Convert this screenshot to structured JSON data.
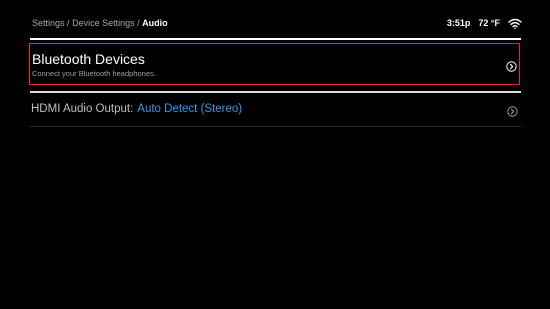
{
  "breadcrumb": {
    "items": [
      "Settings",
      "Device Settings"
    ],
    "separator": "/",
    "current": "Audio"
  },
  "status": {
    "time": "3:51p",
    "temperature": "72 °F",
    "wifi_icon": "wifi-icon"
  },
  "menu": {
    "bluetooth": {
      "title": "Bluetooth Devices",
      "subtitle": "Connect your Bluetooth headphones.",
      "icon": "chevron-right-circle-icon"
    },
    "hdmi": {
      "label": "HDMI Audio Output:",
      "value": "Auto Detect (Stereo)",
      "icon": "chevron-right-circle-icon"
    }
  },
  "colors": {
    "background": "#000000",
    "focus_border": "#e2213a",
    "value_accent": "#2f9be6",
    "breadcrumb": "#a7a7a7"
  }
}
